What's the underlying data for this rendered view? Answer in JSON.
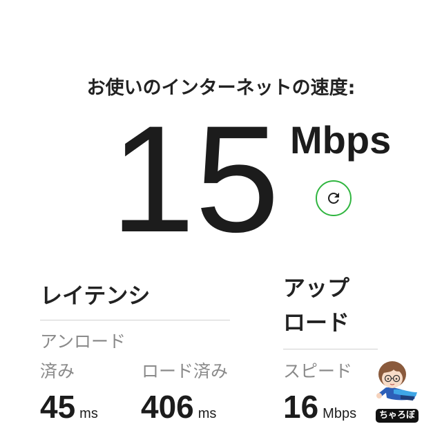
{
  "speed": {
    "title": "お使いのインターネットの速度:",
    "value": "15",
    "unit": "Mbps",
    "refresh_icon": "refresh-icon"
  },
  "latency": {
    "heading": "レイテンシ",
    "unloaded": {
      "label": "アンロード\n済み",
      "value": "45",
      "unit": "ms"
    },
    "loaded": {
      "label": "ロード済み",
      "value": "406",
      "unit": "ms"
    }
  },
  "upload": {
    "heading": "アップ\nロード",
    "label": "スピード",
    "value": "16",
    "unit": "Mbps"
  },
  "watermark": {
    "avatar_icon": "character-avatar-icon",
    "text": "ちゃろぼ"
  },
  "colors": {
    "accent_green": "#2fb53f",
    "text_primary": "#1c1c1c",
    "text_secondary": "#8a8a8a",
    "divider": "#d0d0d0",
    "background": "#ffffff"
  }
}
